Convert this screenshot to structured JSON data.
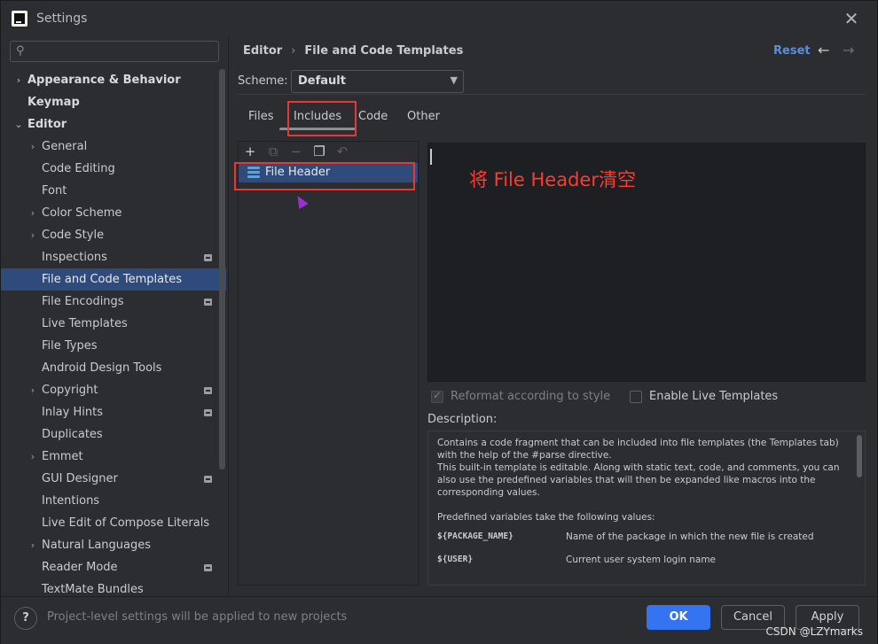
{
  "window": {
    "title": "Settings",
    "close_glyph": "✕"
  },
  "search": {
    "placeholder": "",
    "icon": "search-icon"
  },
  "nav": {
    "items": [
      {
        "label": "Appearance & Behavior",
        "level": 0,
        "bold": true,
        "chevron": "›"
      },
      {
        "label": "Keymap",
        "level": 0,
        "bold": true,
        "chevron": ""
      },
      {
        "label": "Editor",
        "level": 0,
        "bold": true,
        "chevron": "⌄"
      },
      {
        "label": "General",
        "level": 1,
        "chevron": "›"
      },
      {
        "label": "Code Editing",
        "level": 1,
        "chevron": ""
      },
      {
        "label": "Font",
        "level": 1,
        "chevron": ""
      },
      {
        "label": "Color Scheme",
        "level": 1,
        "chevron": "›"
      },
      {
        "label": "Code Style",
        "level": 1,
        "chevron": "›"
      },
      {
        "label": "Inspections",
        "level": 1,
        "chevron": "",
        "mod": true
      },
      {
        "label": "File and Code Templates",
        "level": 1,
        "chevron": "",
        "selected": true
      },
      {
        "label": "File Encodings",
        "level": 1,
        "chevron": "",
        "mod": true
      },
      {
        "label": "Live Templates",
        "level": 1,
        "chevron": ""
      },
      {
        "label": "File Types",
        "level": 1,
        "chevron": ""
      },
      {
        "label": "Android Design Tools",
        "level": 1,
        "chevron": ""
      },
      {
        "label": "Copyright",
        "level": 1,
        "chevron": "›",
        "mod": true
      },
      {
        "label": "Inlay Hints",
        "level": 1,
        "chevron": "",
        "mod": true
      },
      {
        "label": "Duplicates",
        "level": 1,
        "chevron": ""
      },
      {
        "label": "Emmet",
        "level": 1,
        "chevron": "›"
      },
      {
        "label": "GUI Designer",
        "level": 1,
        "chevron": "",
        "mod": true
      },
      {
        "label": "Intentions",
        "level": 1,
        "chevron": ""
      },
      {
        "label": "Live Edit of Compose Literals",
        "level": 1,
        "chevron": ""
      },
      {
        "label": "Natural Languages",
        "level": 1,
        "chevron": "›"
      },
      {
        "label": "Reader Mode",
        "level": 1,
        "chevron": "",
        "mod": true
      },
      {
        "label": "TextMate Bundles",
        "level": 1,
        "chevron": ""
      }
    ]
  },
  "header": {
    "crumb1": "Editor",
    "sep": "›",
    "crumb2": "File and Code Templates",
    "reset": "Reset",
    "back": "←",
    "forward": "→"
  },
  "scheme": {
    "label": "Scheme:",
    "value": "Default",
    "caret": "▼"
  },
  "tabs": {
    "files": "Files",
    "includes": "Includes",
    "code": "Code",
    "other": "Other"
  },
  "toolbar": {
    "add": "+",
    "copy_disabled": "⧉",
    "remove": "−",
    "copy": "❐",
    "revert": "↶"
  },
  "list": {
    "item": "File Header"
  },
  "annotation": {
    "text": "将 File Header清空"
  },
  "options": {
    "reformat": "Reformat according to style",
    "live_templates": "Enable Live Templates"
  },
  "description": {
    "label": "Description:",
    "para1": "Contains a code fragment that can be included into file templates (the Templates tab) with the help of the #parse directive.",
    "para2": "This built-in template is editable. Along with static text, code, and comments, you can also use the predefined variables that will then be expanded like macros into the corresponding values.",
    "para3": "Predefined variables take the following values:",
    "var1_name": "${PACKAGE_NAME}",
    "var1_desc": "Name of the package in which the new file is created",
    "var2_name": "${USER}",
    "var2_desc": "Current user system login name"
  },
  "footer": {
    "help": "?",
    "note": "Project-level settings will be applied to new projects",
    "ok": "OK",
    "cancel": "Cancel",
    "apply": "Apply",
    "watermark": "CSDN @LZYmarks"
  },
  "colors": {
    "accent": "#3574f0",
    "selection": "#2f4b7c",
    "highlight_red": "#e53935",
    "link": "#5a8fd8"
  }
}
